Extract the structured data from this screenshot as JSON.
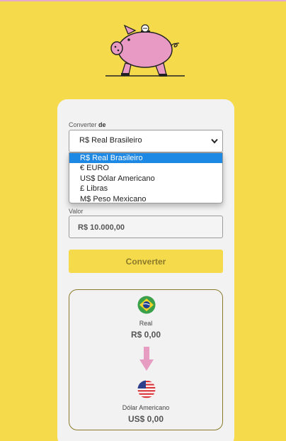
{
  "converter": {
    "from_label_prefix": "Converter",
    "from_label_bold": "de",
    "selected_currency": "R$ Real Brasileiro",
    "options": [
      "R$ Real Brasileiro",
      "€ EURO",
      "US$ Dólar Americano",
      "£ Libras",
      "M$ Peso Mexicano"
    ],
    "value_label": "Valor",
    "value_input": "R$ 10.000,00",
    "convert_button": "Converter"
  },
  "result": {
    "from_name": "Real",
    "from_value": "R$ 0,00",
    "to_name": "Dólar Americano",
    "to_value": "US$ 0,00"
  },
  "colors": {
    "background": "#f5da4c",
    "card": "#f2f2f2",
    "selected_option": "#1e88e5",
    "arrow": "#e79dc2"
  },
  "icons": {
    "logo": "piggy-bank-icon",
    "from_flag": "brazil-flag-icon",
    "to_flag": "usa-flag-icon",
    "arrow": "arrow-down-icon",
    "select": "chevron-down-icon"
  }
}
